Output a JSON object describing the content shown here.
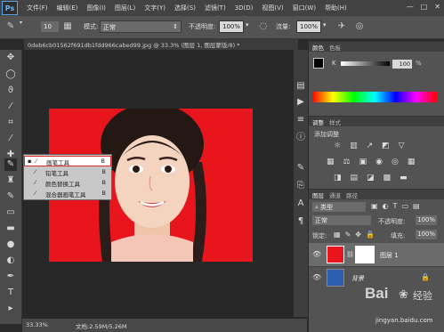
{
  "app": {
    "logo": "Ps"
  },
  "menu": [
    "文件(F)",
    "编辑(E)",
    "图像(I)",
    "图层(L)",
    "文字(Y)",
    "选择(S)",
    "滤镜(T)",
    "3D(D)",
    "视图(V)",
    "窗口(W)",
    "帮助(H)"
  ],
  "window_controls": [
    "—",
    "□",
    "✕"
  ],
  "options": {
    "brush_size": "10",
    "mode_label": "模式:",
    "mode_value": "正常",
    "opacity_label": "不透明度:",
    "opacity_value": "100%",
    "flow_label": "流量:",
    "flow_value": "100%"
  },
  "document": {
    "tab_title": "0deb6cb01562f691db1fdd966cabed99.jpg @ 33.3% (图层 1, 图层蒙版/8) *",
    "zoom": "33.33%",
    "doc_info": "文档:2.59M/5.26M"
  },
  "flyout": {
    "items": [
      {
        "label": "画笔工具",
        "key": "B",
        "selected": true
      },
      {
        "label": "铅笔工具",
        "key": "B",
        "selected": false
      },
      {
        "label": "颜色替换工具",
        "key": "B",
        "selected": false
      },
      {
        "label": "混合器画笔工具",
        "key": "B",
        "selected": false
      }
    ]
  },
  "color_panel": {
    "tabs": [
      "颜色",
      "色板"
    ],
    "slider_label": "K",
    "slider_value": "100",
    "slider_unit": "%"
  },
  "adjust_panel": {
    "tabs": [
      "调整",
      "样式"
    ],
    "title": "添加调整"
  },
  "layers_panel": {
    "tabs": [
      "图层",
      "通道",
      "路径"
    ],
    "filter_label": "类型",
    "blend_mode": "正常",
    "opacity_label": "不透明度:",
    "opacity_value": "100%",
    "lock_label": "锁定:",
    "fill_label": "填充:",
    "fill_value": "100%",
    "layers": [
      {
        "name": "图层 1"
      },
      {
        "name": "背景"
      }
    ]
  },
  "watermark": {
    "text1": "Bai",
    "text2": "经验",
    "url": "jingyan.baidu.com"
  },
  "colors": {
    "canvas_red": "#e8151d",
    "selection_border": "#d92b2b",
    "ps_blue": "#69b3f3"
  }
}
